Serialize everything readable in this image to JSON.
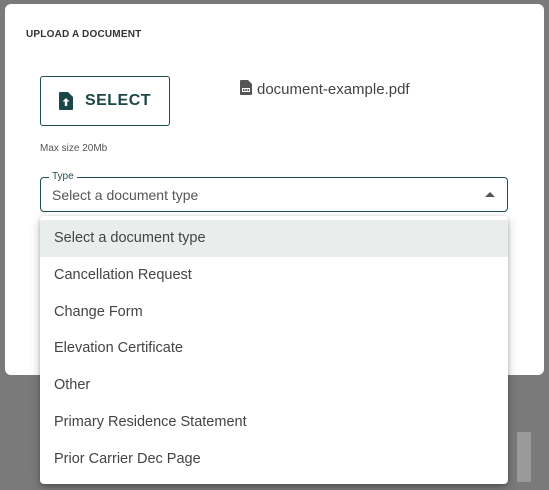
{
  "modal": {
    "title": "UPLOAD A DOCUMENT",
    "select_button_label": "SELECT",
    "file_name": "document-example.pdf",
    "max_size_note": "Max size 20Mb",
    "type_field": {
      "label": "Type",
      "value": "Select a document type"
    }
  },
  "dropdown": {
    "options": [
      "Select a document type",
      "Cancellation Request",
      "Change Form",
      "Elevation Certificate",
      "Other",
      "Primary Residence Statement",
      "Prior Carrier Dec Page"
    ],
    "selected_index": 0
  },
  "colors": {
    "accent": "#1f4f4f",
    "selected_option_bg": "#e9eeed",
    "backdrop": "#7a7a7a"
  },
  "icons": {
    "upload": "file-upload-icon",
    "pdf": "pdf-file-icon",
    "dropdown_arrow": "caret-up-icon"
  }
}
